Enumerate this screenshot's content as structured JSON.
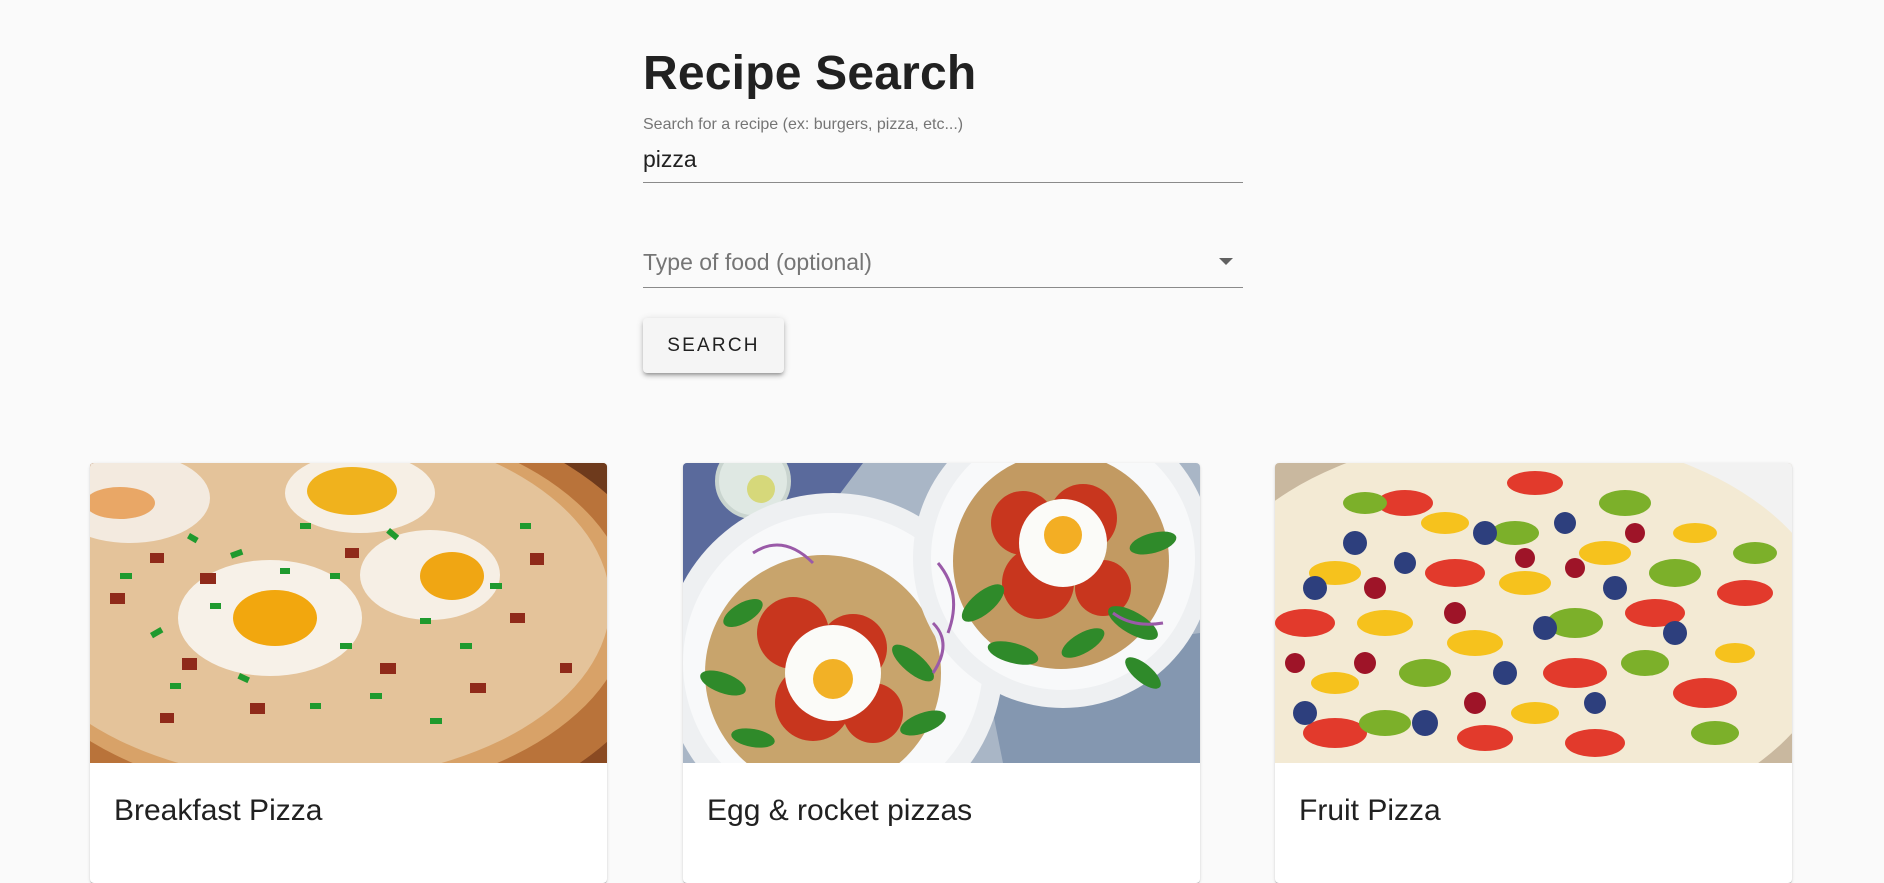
{
  "page": {
    "title": "Recipe Search"
  },
  "search": {
    "label": "Search for a recipe (ex: burgers, pizza, etc...)",
    "value": "pizza"
  },
  "food_type": {
    "placeholder": "Type of food (optional)",
    "icon": "arrow-drop-down-icon"
  },
  "search_button": {
    "label": "SEARCH"
  },
  "recipes": [
    {
      "title": "Breakfast Pizza",
      "image": "breakfast-pizza-photo"
    },
    {
      "title": "Egg & rocket pizzas",
      "image": "egg-rocket-pizzas-photo"
    },
    {
      "title": "Fruit Pizza",
      "image": "fruit-pizza-photo"
    }
  ],
  "colors": {
    "background": "#fafafa",
    "text": "#212121",
    "muted_text": "#757575",
    "card": "#ffffff",
    "button": "#f5f5f5"
  }
}
